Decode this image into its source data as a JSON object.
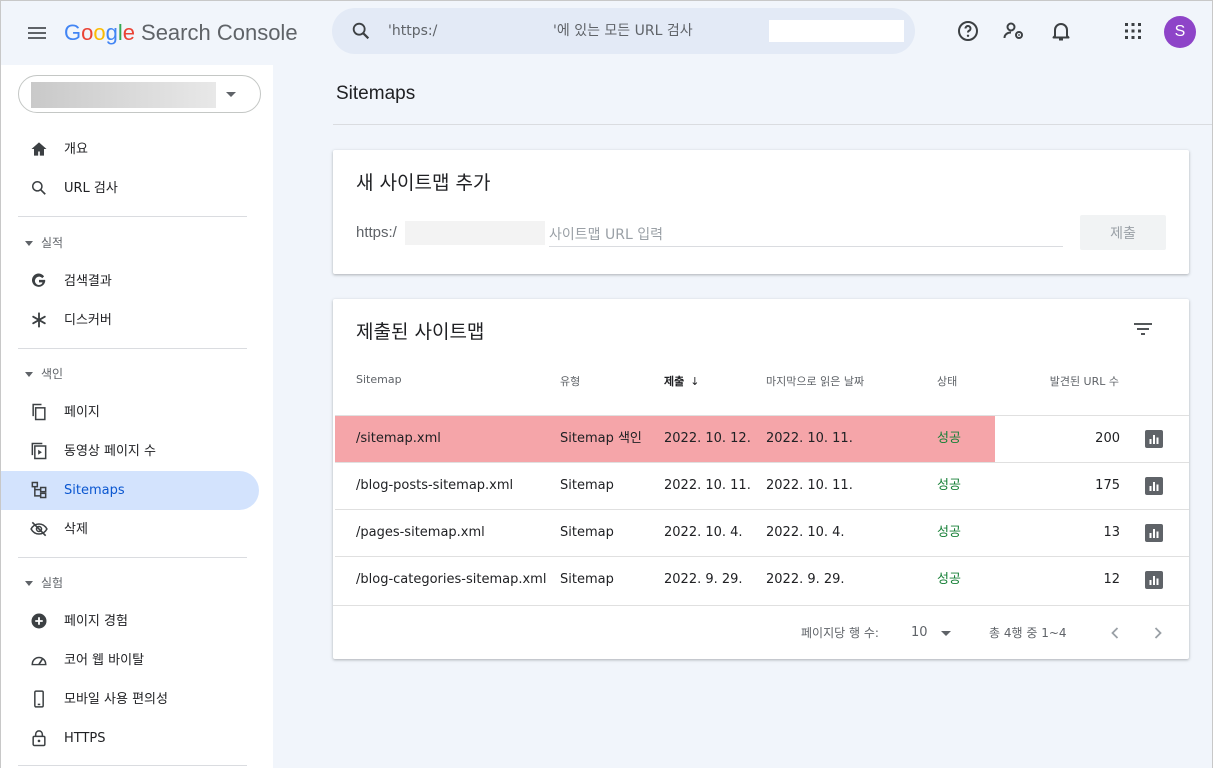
{
  "header": {
    "logo_google_letters": [
      "G",
      "o",
      "o",
      "g",
      "l",
      "e"
    ],
    "logo_product": "Search Console",
    "search_placeholder": "'https:/                          '에 있는 모든 URL 검사",
    "avatar_letter": "S",
    "icons": [
      "menu-icon",
      "search-icon",
      "help-icon",
      "manage-users-icon",
      "notifications-icon",
      "apps-icon"
    ]
  },
  "sidebar": {
    "items": [
      {
        "label": "개요",
        "icon": "home-icon"
      },
      {
        "label": "URL 검사",
        "icon": "search-icon"
      }
    ],
    "sections": [
      {
        "label": "실적",
        "items": [
          {
            "label": "검색결과",
            "icon": "google-g-icon"
          },
          {
            "label": "디스커버",
            "icon": "asterisk-icon"
          }
        ]
      },
      {
        "label": "색인",
        "items": [
          {
            "label": "페이지",
            "icon": "pages-icon"
          },
          {
            "label": "동영상 페이지 수",
            "icon": "video-page-icon"
          },
          {
            "label": "Sitemaps",
            "icon": "sitemap-icon",
            "active": true
          },
          {
            "label": "삭제",
            "icon": "eye-off-icon"
          }
        ]
      },
      {
        "label": "실험",
        "items": [
          {
            "label": "페이지 경험",
            "icon": "plus-circle-icon"
          },
          {
            "label": "코어 웹 바이탈",
            "icon": "gauge-icon"
          },
          {
            "label": "모바일 사용 편의성",
            "icon": "smartphone-icon"
          },
          {
            "label": "HTTPS",
            "icon": "lock-icon"
          }
        ]
      }
    ]
  },
  "main": {
    "title": "Sitemaps",
    "add_card": {
      "title": "새 사이트맵 추가",
      "prefix": "https:/",
      "input_placeholder": "사이트맵 URL 입력",
      "submit_label": "제출"
    },
    "list_card": {
      "title": "제출된 사이트맵",
      "columns": [
        "Sitemap",
        "유형",
        "제출",
        "마지막으로 읽은 날짜",
        "상태",
        "발견된 URL 수"
      ],
      "sort_arrow": "↓",
      "rows": [
        {
          "sitemap": "/sitemap.xml",
          "type": "Sitemap 색인",
          "submitted": "2022. 10. 12.",
          "last_read": "2022. 10. 11.",
          "status": "성공",
          "urls": "200",
          "highlighted": true
        },
        {
          "sitemap": "/blog-posts-sitemap.xml",
          "type": "Sitemap",
          "submitted": "2022. 10. 11.",
          "last_read": "2022. 10. 11.",
          "status": "성공",
          "urls": "175"
        },
        {
          "sitemap": "/pages-sitemap.xml",
          "type": "Sitemap",
          "submitted": "2022. 10. 4.",
          "last_read": "2022. 10. 4.",
          "status": "성공",
          "urls": "13"
        },
        {
          "sitemap": "/blog-categories-sitemap.xml",
          "type": "Sitemap",
          "submitted": "2022. 9. 29.",
          "last_read": "2022. 9. 29.",
          "status": "성공",
          "urls": "12"
        }
      ],
      "footer": {
        "rows_per_page_label": "페이지당 행 수:",
        "rows_per_page_value": "10",
        "range_label": "총 4행 중 1~4"
      }
    }
  },
  "colors": {
    "header_bg": "#f1f5fb",
    "active_nav_bg": "#d3e3fd",
    "highlight_row": "#f5a5a9",
    "success": "#188038",
    "avatar": "#8e44c8"
  }
}
